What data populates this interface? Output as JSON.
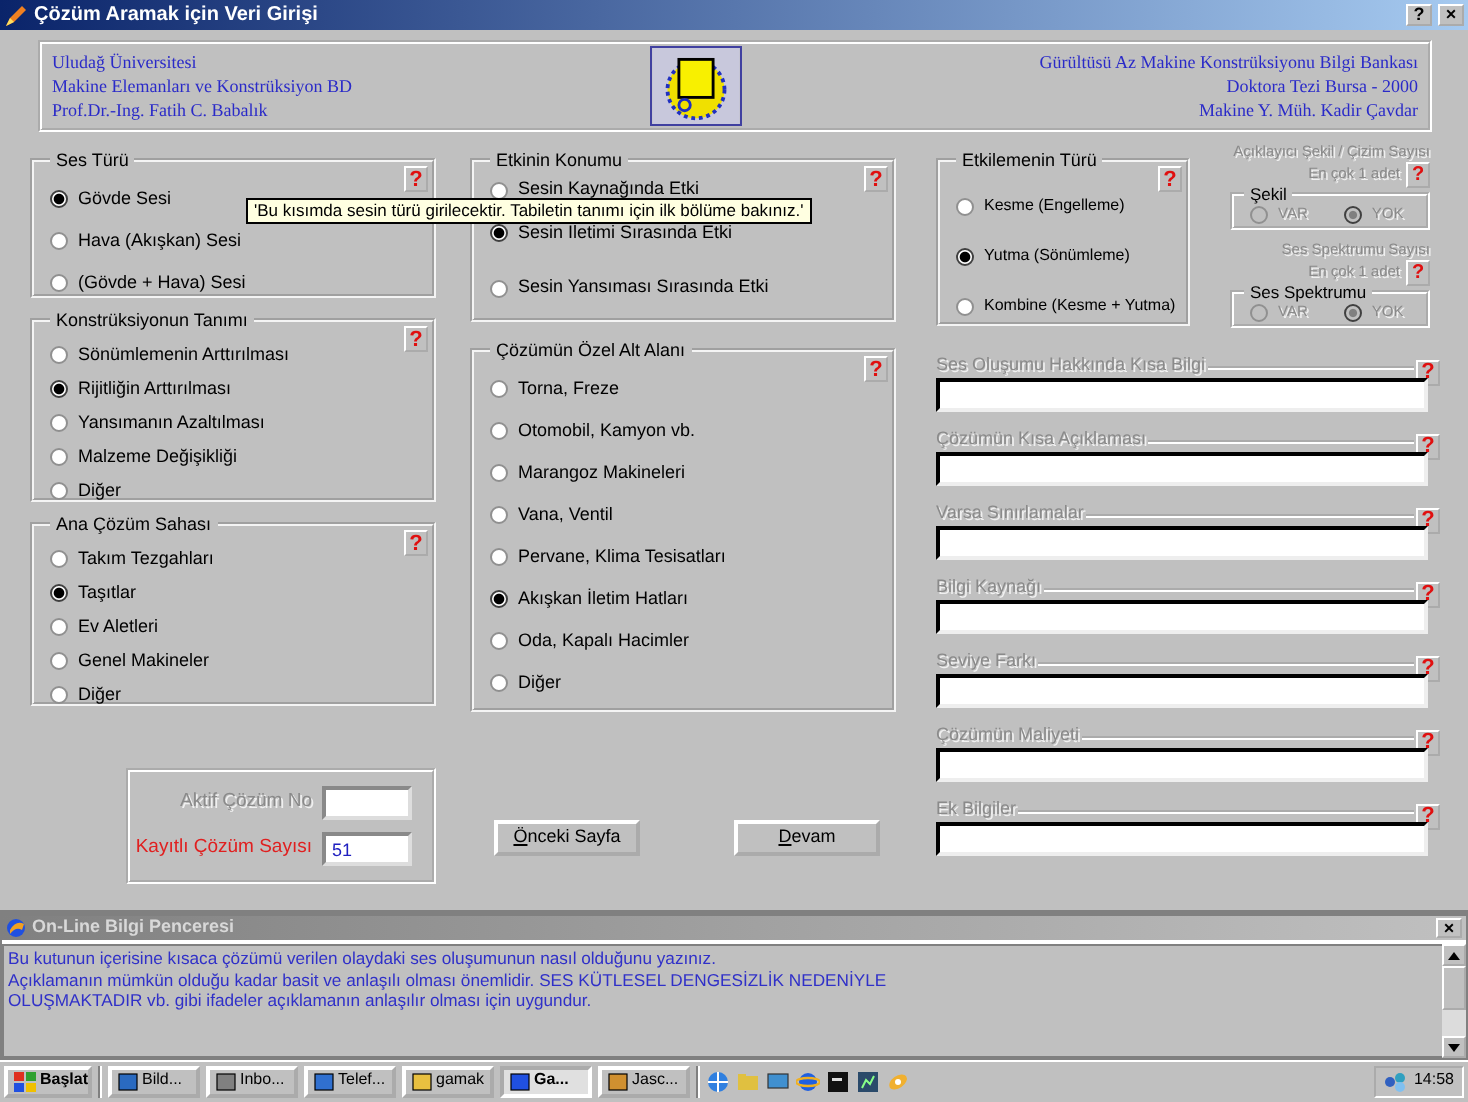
{
  "window": {
    "title": "Çözüm Aramak için Veri Girişi",
    "controls": [
      "?",
      "×"
    ]
  },
  "header": {
    "left_lines": [
      "Uludağ Üniversitesi",
      "Makine Elemanları ve Konstrüksiyon BD",
      "Prof.Dr.-Ing. Fatih C. Babalık"
    ],
    "right_lines": [
      "Gürültüsü Az Makine Konstrüksiyonu Bilgi Bankası",
      "Doktora Tezi Bursa - 2000",
      "Makine Y. Müh. Kadir Çavdar"
    ]
  },
  "column_1": [
    {
      "title": "Ses Türü",
      "help": "?",
      "options": [
        {
          "label": "Gövde Sesi",
          "selected": true
        },
        {
          "label": "Hava (Akışkan) Sesi",
          "selected": false
        },
        {
          "label": "(Gövde + Hava) Sesi",
          "selected": false
        }
      ]
    },
    {
      "title": "Konstrüksiyonun Tanımı",
      "help": "?",
      "options": [
        {
          "label": "Sönümlemenin Arttırılması",
          "selected": false
        },
        {
          "label": "Rijitliğin Arttırılması",
          "selected": true
        },
        {
          "label": "Yansımanın Azaltılması",
          "selected": false
        },
        {
          "label": "Malzeme Değişikliği",
          "selected": false
        },
        {
          "label": "Diğer",
          "selected": false
        }
      ]
    },
    {
      "title": "Ana Çözüm Sahası",
      "help": "?",
      "options": [
        {
          "label": "Takım Tezgahları",
          "selected": false
        },
        {
          "label": "Taşıtlar",
          "selected": true
        },
        {
          "label": "Ev Aletleri",
          "selected": false
        },
        {
          "label": "Genel Makineler",
          "selected": false
        },
        {
          "label": "Diğer",
          "selected": false
        }
      ]
    }
  ],
  "column_2": [
    {
      "title": "Etkinin Konumu",
      "help": "?",
      "options": [
        {
          "label": "Sesin Kaynağında Etki",
          "selected": false
        },
        {
          "label": "Sesin İletimi Sırasında Etki",
          "selected": true
        },
        {
          "label": "Sesin Yansıması Sırasında Etki",
          "selected": false
        }
      ]
    },
    {
      "title": "Çözümün Özel Alt Alanı",
      "help": "?",
      "options": [
        {
          "label": "Torna, Freze",
          "selected": false
        },
        {
          "label": "Otomobil, Kamyon vb.",
          "selected": false
        },
        {
          "label": "Marangoz Makineleri",
          "selected": false
        },
        {
          "label": "Vana, Ventil",
          "selected": false
        },
        {
          "label": "Pervane, Klima Tesisatları",
          "selected": false
        },
        {
          "label": "Akışkan İletim Hatları",
          "selected": true
        },
        {
          "label": "Oda, Kapalı Hacimler",
          "selected": false
        },
        {
          "label": "Diğer",
          "selected": false
        }
      ]
    }
  ],
  "tooltip": {
    "text": "'Bu kısımda sesin türü girilecektir. Tabiletin tanımı için ilk bölüme bakınız.'"
  },
  "counter_panel": [
    {
      "label": "Aktif Çözüm No",
      "disabled": true,
      "highlighted": false
    },
    {
      "label": "Kayıtlı Çözüm Sayısı",
      "value": "51",
      "disabled": false,
      "highlighted": true
    }
  ],
  "buttons": [
    {
      "label": "Önceki Sayfa"
    },
    {
      "label": "Devam"
    }
  ],
  "effect_type": {
    "title": "Etkilemenin Türü",
    "help": "?",
    "options": [
      {
        "label": "Kesme (Engelleme)",
        "selected": false
      },
      {
        "label": "Yutma (Sönümleme)",
        "selected": true
      },
      {
        "label": "Kombine (Kesme + Yutma)",
        "selected": false
      }
    ]
  },
  "attachments": [
    {
      "title": "Açıklayıcı Şekil / Çizim Sayısı",
      "limit": "En çok 1 adet",
      "help": "?",
      "group": "Şekil",
      "disabled": true,
      "options": [
        {
          "label": "VAR",
          "selected": false
        },
        {
          "label": "YOK",
          "selected": true
        }
      ]
    },
    {
      "title": "Ses Spektrumu Sayısı",
      "limit": "En çok 1 adet",
      "help": "?",
      "group": "Ses Spektrumu",
      "disabled": true,
      "options": [
        {
          "label": "VAR",
          "selected": false
        },
        {
          "label": "YOK",
          "selected": true
        }
      ]
    }
  ],
  "text_fields": [
    {
      "label": "Ses Oluşumu Hakkında Kısa Bilgi",
      "help": "?",
      "disabled": true
    },
    {
      "label": "Çözümün Kısa Açıklaması",
      "help": "?",
      "disabled": true
    },
    {
      "label": "Varsa Sınırlamalar",
      "help": "?",
      "disabled": true
    },
    {
      "label": "Bilgi Kaynağı",
      "help": "?",
      "disabled": true
    },
    {
      "label": "Seviye Farkı",
      "help": "?",
      "disabled": true
    },
    {
      "label": "Çözümün Maliyeti",
      "help": "?",
      "disabled": true
    },
    {
      "label": "Ek Bilgiler",
      "help": "?",
      "disabled": true
    }
  ],
  "info_panel": {
    "title": "On-Line Bilgi Penceresi",
    "close": "×",
    "lines": [
      "Bu kutunun içerisine kısaca çözümü verilen olaydaki ses oluşumunun nasıl olduğunu yazınız.",
      "Açıklamanın mümkün olduğu kadar basit ve anlaşılı olması önemlidir. SES KÜTLESEL DENGESİZLİK NEDENİYLE",
      "OLUŞMAKTADIR vb. gibi ifadeler açıklamanın anlaşılır olması için uygundur."
    ]
  },
  "taskbar": {
    "start": "Başlat",
    "tasks": [
      {
        "label": "Bild...",
        "selected": false
      },
      {
        "label": "Inbo...",
        "selected": false
      },
      {
        "label": "Telef...",
        "selected": false
      },
      {
        "label": "gamak",
        "selected": false
      },
      {
        "label": "Ga...",
        "selected": true
      },
      {
        "label": "Jasc...",
        "selected": false
      }
    ],
    "clock": "14:58"
  }
}
